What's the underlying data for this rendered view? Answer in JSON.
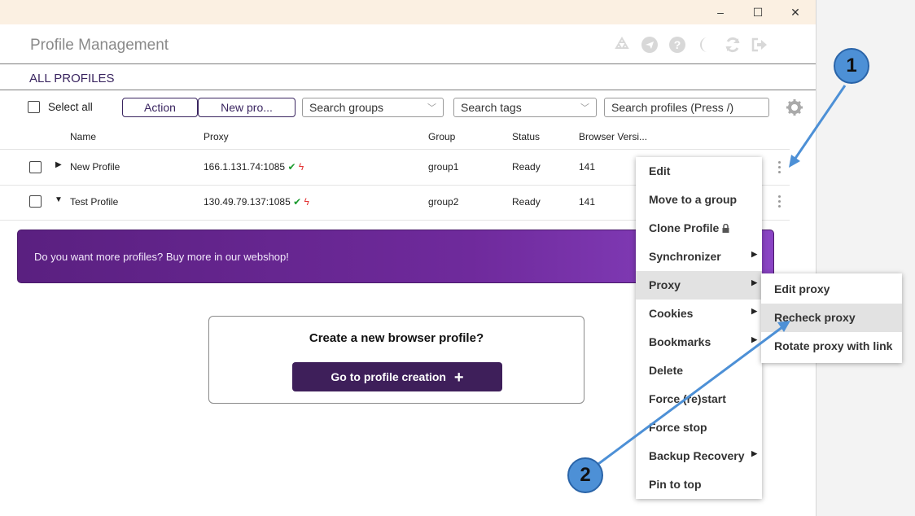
{
  "window": {
    "controls": {
      "minimize": "–",
      "maximize": "☐",
      "close": "✕"
    }
  },
  "header": {
    "title": "Profile Management",
    "icons": [
      "recycle-icon",
      "telegram-icon",
      "help-icon",
      "moon-icon",
      "refresh-icon",
      "logout-icon"
    ]
  },
  "section": {
    "title": "ALL PROFILES"
  },
  "toolbar": {
    "select_all": "Select all",
    "action": "Action",
    "new_profile": "New pro...",
    "search_groups": "Search groups",
    "search_tags": "Search tags",
    "search_profiles": "Search profiles (Press /)"
  },
  "table": {
    "columns": [
      "Name",
      "Proxy",
      "Group",
      "Status",
      "Browser Versi..."
    ],
    "rows": [
      {
        "name": "New Profile",
        "proxy": "166.1.131.74:1085",
        "group": "group1",
        "status": "Ready",
        "version": "141"
      },
      {
        "name": "Test Profile",
        "proxy": "130.49.79.137:1085",
        "group": "group2",
        "status": "Ready",
        "version": "141"
      }
    ]
  },
  "banner": {
    "text": "Do you want more profiles? Buy more in our webshop!"
  },
  "create": {
    "title": "Create a new browser profile?",
    "button": "Go to profile creation",
    "button_icon": "+"
  },
  "context_menu": {
    "items": [
      "Edit",
      "Move to a group",
      "Clone Profile",
      "Synchronizer",
      "Proxy",
      "Cookies",
      "Bookmarks",
      "Delete",
      "Force (re)start",
      "Force stop",
      "Backup Recovery",
      "Pin to top"
    ]
  },
  "submenu": {
    "items": [
      "Edit proxy",
      "Recheck proxy",
      "Rotate proxy with link"
    ]
  },
  "annotations": {
    "badge1": "1",
    "badge2": "2"
  },
  "colors": {
    "accent": "#3e1f5a",
    "titlebar": "#fbf0e2",
    "banner": "#6f2a9c",
    "annotation": "#4d90d6"
  }
}
